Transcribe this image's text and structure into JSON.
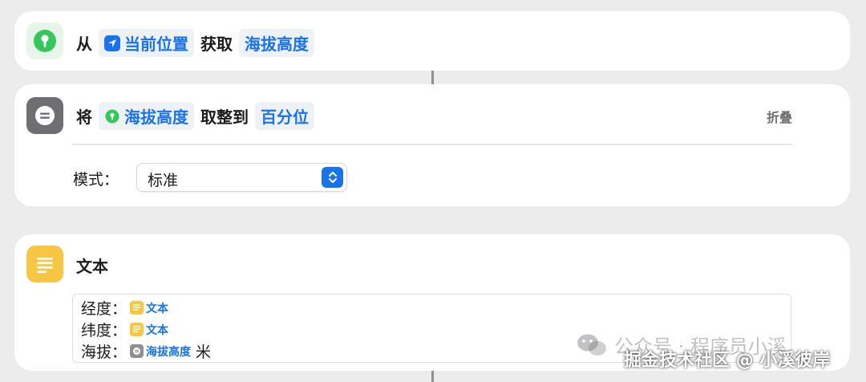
{
  "action1": {
    "prefix": "从",
    "location_token": "当前位置",
    "verb": "获取",
    "property_token": "海拔高度",
    "icon": "location-pin-icon",
    "accent": "#34c759"
  },
  "action2": {
    "prefix": "将",
    "value_token": "海拔高度",
    "verb": "取整到",
    "precision_token": "百分位",
    "fold_label": "折叠",
    "mode_label": "模式：",
    "mode_value": "标准",
    "icon": "round-number-icon",
    "accent": "#8e8e93"
  },
  "action3": {
    "title": "文本",
    "icon": "text-lines-icon",
    "accent": "#f7c744",
    "lines": [
      {
        "label": "经度：",
        "token": "文本",
        "suffix": ""
      },
      {
        "label": "纬度：",
        "token": "文本",
        "suffix": ""
      },
      {
        "label": "海拔：",
        "token": "海拔高度",
        "suffix": "米"
      }
    ]
  },
  "watermark": {
    "line1": "公众号 · 程序员小溪",
    "line2": "掘金技术社区 @ 小溪彼岸"
  },
  "colors": {
    "token_text": "#1a73e8",
    "background": "#ececec"
  }
}
